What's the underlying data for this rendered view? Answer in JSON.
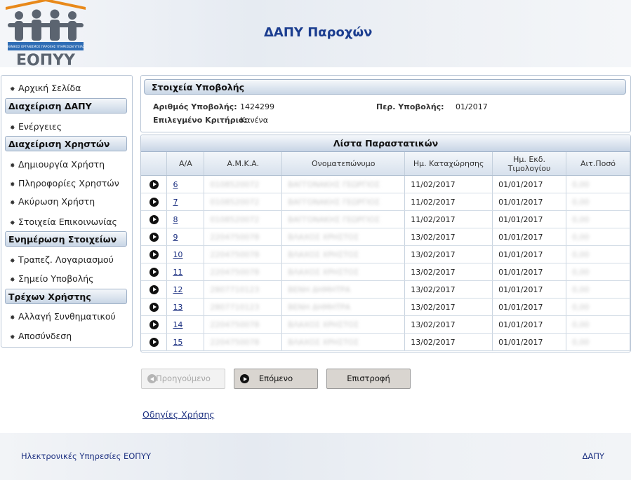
{
  "header": {
    "logo_text": "ΕΟΠΥΥ",
    "logo_subtitle": "ΕΘΝΙΚΟΣ ΟΡΓΑΝΙΣΜΟΣ ΠΑΡΟΧΗΣ ΥΠΗΡΕΣΙΩΝ ΥΓΕΙΑΣ",
    "title": "ΔΑΠΥ Παροχών"
  },
  "sidebar": {
    "home": "Αρχική Σελίδα",
    "section_dapy": "Διαχείριση ΔΑΠΥ",
    "actions": "Ενέργειες",
    "section_users": "Διαχείριση Χρηστών",
    "create_user": "Δημιουργία Χρήστη",
    "user_info": "Πληροφορίες Χρηστών",
    "cancel_user": "Ακύρωση Χρήστη",
    "contact_info": "Στοιχεία Επικοινωνίας",
    "section_update": "Ενημέρωση Στοιχείων",
    "bank_account": "Τραπεζ. Λογαριασμού",
    "submission_point": "Σημείο Υποβολής",
    "section_current": "Τρέχων Χρήστης",
    "change_password": "Αλλαγή Συνθηματικού",
    "logout": "Αποσύνδεση"
  },
  "submission": {
    "title": "Στοιχεία Υποβολής",
    "number_label": "Αριθμός Υποβολής:",
    "number_value": "1424299",
    "period_label": "Περ. Υποβολής:",
    "period_value": "01/2017",
    "criterion_label": "Επιλεγμένο Κριτήριο:",
    "criterion_value": "Κανένα"
  },
  "list": {
    "title": "Λίστα Παραστατικών",
    "columns": [
      "Α/Α",
      "Α.Μ.Κ.Α.",
      "Ονοματεπώνυμο",
      "Ημ. Καταχώρησης",
      "Ημ. Εκδ. Τιμολογίου",
      "Αιτ.Ποσό"
    ],
    "rows": [
      {
        "aa": "6",
        "amka": "0108520072",
        "name": "ΒΑΓΓΟΝΑΚΗΣ ΓΕΩΡΓΙΟΣ",
        "reg": "11/02/2017",
        "inv": "01/01/2017",
        "amount": "0,00"
      },
      {
        "aa": "7",
        "amka": "0108520072",
        "name": "ΒΑΓΓΟΝΑΚΗΣ ΓΕΩΡΓΙΟΣ",
        "reg": "11/02/2017",
        "inv": "01/01/2017",
        "amount": "0,00"
      },
      {
        "aa": "8",
        "amka": "0108520072",
        "name": "ΒΑΓΓΟΝΑΚΗΣ ΓΕΩΡΓΙΟΣ",
        "reg": "11/02/2017",
        "inv": "01/01/2017",
        "amount": "0,00"
      },
      {
        "aa": "9",
        "amka": "2204750078",
        "name": "ΒΛΑΧΟΣ ΧΡΗΣΤΟΣ",
        "reg": "13/02/2017",
        "inv": "01/01/2017",
        "amount": "0,00"
      },
      {
        "aa": "10",
        "amka": "2204750078",
        "name": "ΒΛΑΧΟΣ ΧΡΗΣΤΟΣ",
        "reg": "13/02/2017",
        "inv": "01/01/2017",
        "amount": "0,00"
      },
      {
        "aa": "11",
        "amka": "2204750078",
        "name": "ΒΛΑΧΟΣ ΧΡΗΣΤΟΣ",
        "reg": "13/02/2017",
        "inv": "01/01/2017",
        "amount": "0,00"
      },
      {
        "aa": "12",
        "amka": "2807710123",
        "name": "ΒΕΝΗ ΔΗΜΗΤΡΑ",
        "reg": "13/02/2017",
        "inv": "01/01/2017",
        "amount": "0,00"
      },
      {
        "aa": "13",
        "amka": "2807710123",
        "name": "ΒΕΝΗ ΔΗΜΗΤΡΑ",
        "reg": "13/02/2017",
        "inv": "01/01/2017",
        "amount": "0,00"
      },
      {
        "aa": "14",
        "amka": "2204750078",
        "name": "ΒΛΑΧΟΣ ΧΡΗΣΤΟΣ",
        "reg": "13/02/2017",
        "inv": "01/01/2017",
        "amount": "0,00"
      },
      {
        "aa": "15",
        "amka": "2204750078",
        "name": "ΒΛΑΧΟΣ ΧΡΗΣΤΟΣ",
        "reg": "13/02/2017",
        "inv": "01/01/2017",
        "amount": "0,00"
      }
    ]
  },
  "buttons": {
    "prev": "Προηγούμενο",
    "next": "Επόμενο",
    "back": "Επιστροφή"
  },
  "help_link": "Οδηγίες Χρήσης",
  "footer": {
    "left": "Ηλεκτρονικές Υπηρεσίες ΕΟΠΥΥ",
    "right": "ΔΑΠΥ"
  },
  "colors": {
    "brand_blue": "#1b3d8f",
    "logo_orange": "#e8891a",
    "logo_gray": "#5b6470"
  }
}
